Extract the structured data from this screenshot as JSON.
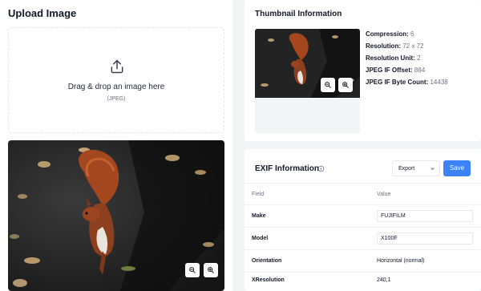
{
  "upload": {
    "title": "Upload Image",
    "dropzone_text": "Drag & drop an image here",
    "dropzone_sub": "(JPEG)",
    "icon": "upload-icon"
  },
  "thumbnail": {
    "title": "Thumbnail Information",
    "info": [
      {
        "label": "Compression:",
        "value": "6"
      },
      {
        "label": "Resolution:",
        "value": "72 x 72"
      },
      {
        "label": "Resolution Unit:",
        "value": "2"
      },
      {
        "label": "JPEG IF Offset:",
        "value": "884"
      },
      {
        "label": "JPEG IF Byte Count:",
        "value": "14438"
      }
    ]
  },
  "exif": {
    "title": "EXIF Information",
    "export_label": "Export",
    "save_label": "Save",
    "columns": {
      "field": "Field",
      "value": "Value"
    },
    "rows": [
      {
        "field": "Make",
        "value": "FUJIFILM"
      },
      {
        "field": "Model",
        "value": "X100F"
      },
      {
        "field": "Orientation",
        "value": "Horizontal (normal)"
      },
      {
        "field": "XResolution",
        "value": "240,1"
      }
    ]
  },
  "colors": {
    "accent": "#3b82f6",
    "background": "#f3f4f6",
    "card": "#ffffff"
  }
}
